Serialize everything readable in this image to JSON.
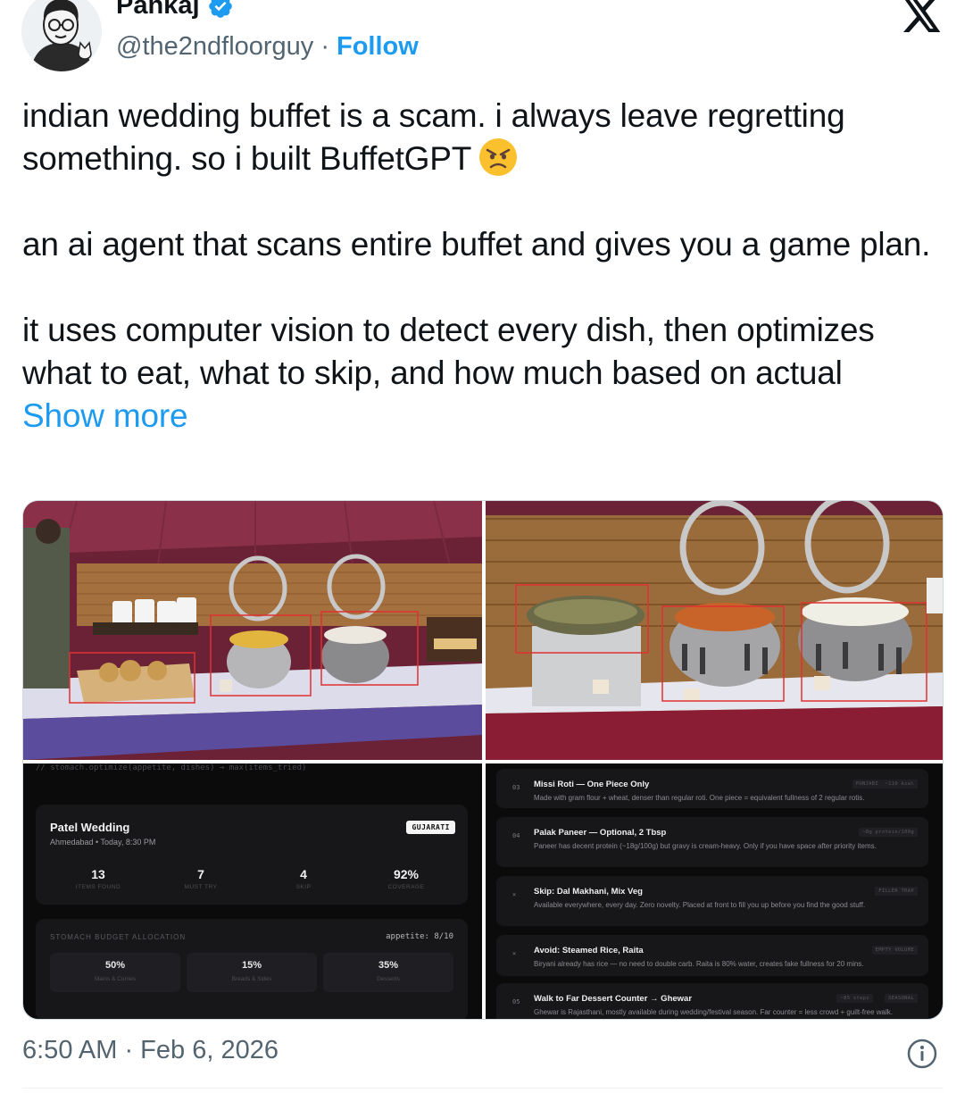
{
  "author": {
    "name": "Pankaj",
    "handle": "@the2ndfloorguy",
    "separator": "·",
    "follow_label": "Follow"
  },
  "icons": {
    "verified": "verified-badge-icon",
    "platform": "x-logo-icon",
    "emoji": "angry-face-emoji",
    "info": "info-icon"
  },
  "tweet": {
    "paragraph1": "indian wedding buffet is a scam. i always leave regretting something. so i built BuffetGPT",
    "paragraph2": "an ai agent that scans entire buffet and gives you a game plan.",
    "paragraph3": "it uses computer vision to detect every dish, then optimizes what to eat, what to skip, and how much based on actual",
    "show_more": "Show more"
  },
  "dashboard": {
    "code_comment": "// stomach.optimize(appetite, dishes) → max(items_tried)",
    "event_title": "Patel Wedding",
    "event_subtitle": "Ahmedabad • Today, 8:30 PM",
    "cuisine_tag": "GUJARATI",
    "stats": [
      {
        "value": "13",
        "label": "ITEMS FOUND"
      },
      {
        "value": "7",
        "label": "MUST TRY"
      },
      {
        "value": "4",
        "label": "SKIP"
      },
      {
        "value": "92%",
        "label": "COVERAGE"
      }
    ],
    "budget_title": "STOMACH BUDGET ALLOCATION",
    "appetite": "appetite: 8/10",
    "allocation": [
      {
        "value": "50%",
        "label": "Mains & Curries"
      },
      {
        "value": "15%",
        "label": "Breads & Sides"
      },
      {
        "value": "35%",
        "label": "Desserts"
      }
    ]
  },
  "plan": [
    {
      "num": "03",
      "title": "Missi Roti — One Piece Only",
      "desc": "Made with gram flour + wheat, denser than regular roti. One piece = equivalent fullness of 2 regular rotis.",
      "badges": [
        "PUNJABI",
        "~110 kcal"
      ]
    },
    {
      "num": "04",
      "title": "Palak Paneer — Optional, 2 Tbsp",
      "desc": "Paneer has decent protein (~18g/100g) but gravy is cream-heavy. Only if you have space after priority items.",
      "badges": [
        "~8g protein/100g"
      ]
    },
    {
      "num": "×",
      "title": "Skip: Dal Makhani, Mix Veg",
      "desc": "Available everywhere, every day. Zero novelty. Placed at front to fill you up before you find the good stuff.",
      "badges": [
        "FILLER TRAP"
      ]
    },
    {
      "num": "×",
      "title": "Avoid: Steamed Rice, Raita",
      "desc": "Biryani already has rice — no need to double carb. Raita is 80% water, creates fake fullness for 20 mins.",
      "badges": [
        "EMPTY VOLUME"
      ]
    },
    {
      "num": "05",
      "title": "Walk to Far Dessert Counter → Ghewar",
      "desc": "Ghewar is Rajasthani, mostly available during wedding/festival season. Far counter = less crowd + guilt-free walk.",
      "badges": [
        "~85 steps",
        "SEASONAL"
      ]
    }
  ],
  "footer": {
    "timestamp": "6:50 AM · Feb 6, 2026"
  }
}
